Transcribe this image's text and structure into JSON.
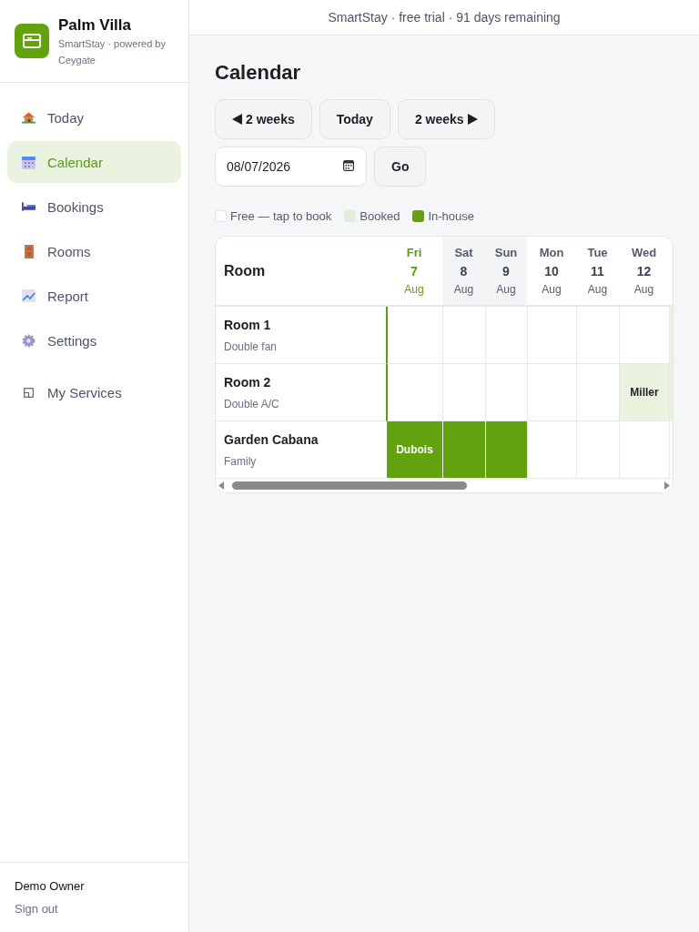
{
  "sidebar": {
    "brand": {
      "name": "Palm Villa",
      "tagline": "SmartStay · powered by Ceygate"
    },
    "items": [
      {
        "kind": "house",
        "label": "Today",
        "selected": false
      },
      {
        "kind": "calendar",
        "label": "Calendar",
        "selected": true
      },
      {
        "kind": "bed",
        "label": "Bookings",
        "selected": false
      },
      {
        "kind": "door",
        "label": "Rooms",
        "selected": false
      },
      {
        "kind": "chart",
        "label": "Report",
        "selected": false
      },
      {
        "kind": "gear",
        "label": "Settings",
        "selected": false
      },
      {
        "kind": "window",
        "label": "My Services",
        "selected": false
      }
    ],
    "user": {
      "name": "Demo Owner",
      "sign_out": "Sign out"
    }
  },
  "banner": "SmartStay · free trial · 91 days remaining",
  "page_title": "Calendar",
  "nav_buttons": [
    {
      "kind": "prev",
      "label": "2 weeks"
    },
    {
      "kind": "plain",
      "label": "Today"
    },
    {
      "kind": "next",
      "label": "2 weeks"
    }
  ],
  "date_field": {
    "value": "08/07/2026"
  },
  "go_button": "Go",
  "legend": [
    {
      "kind": "free",
      "label": "Free — tap to book"
    },
    {
      "kind": "booked",
      "label": "Booked"
    },
    {
      "kind": "inhouse",
      "label": "In-house"
    }
  ],
  "grid": {
    "room_header": "Room",
    "days": [
      {
        "weekday": "Fri",
        "day": "7",
        "month": "Aug",
        "today": true,
        "weekend": false
      },
      {
        "weekday": "Sat",
        "day": "8",
        "month": "Aug",
        "today": false,
        "weekend": true
      },
      {
        "weekday": "Sun",
        "day": "9",
        "month": "Aug",
        "today": false,
        "weekend": true
      },
      {
        "weekday": "Mon",
        "day": "10",
        "month": "Aug",
        "today": false,
        "weekend": false
      },
      {
        "weekday": "Tue",
        "day": "11",
        "month": "Aug",
        "today": false,
        "weekend": false
      },
      {
        "weekday": "Wed",
        "day": "12",
        "month": "Aug",
        "today": false,
        "weekend": false
      }
    ],
    "rooms": [
      {
        "name": "Room 1",
        "type": "Double fan",
        "cells": [
          {
            "kind": "free"
          },
          {
            "kind": "free"
          },
          {
            "kind": "free"
          },
          {
            "kind": "free"
          },
          {
            "kind": "free"
          },
          {
            "kind": "free"
          },
          {
            "kind": "booked"
          }
        ]
      },
      {
        "name": "Room 2",
        "type": "Double A/C",
        "cells": [
          {
            "kind": "free"
          },
          {
            "kind": "free"
          },
          {
            "kind": "free"
          },
          {
            "kind": "free"
          },
          {
            "kind": "free"
          },
          {
            "kind": "booked",
            "guest": "Miller"
          },
          {
            "kind": "booked"
          }
        ]
      },
      {
        "name": "Garden Cabana",
        "type": "Family",
        "cells": [
          {
            "kind": "inhouse",
            "guest": "Dubois"
          },
          {
            "kind": "inhouse"
          },
          {
            "kind": "inhouse"
          },
          {
            "kind": "free"
          },
          {
            "kind": "free"
          },
          {
            "kind": "free"
          },
          {
            "kind": "free"
          }
        ]
      }
    ]
  }
}
